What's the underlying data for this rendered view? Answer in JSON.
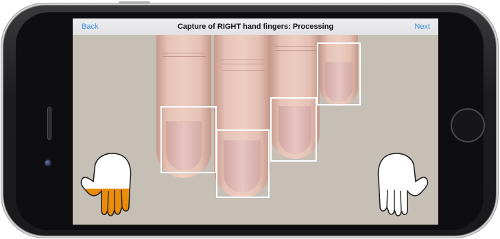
{
  "nav": {
    "back_label": "Back",
    "title": "Capture of RIGHT hand fingers: Processing",
    "next_label": "Next"
  },
  "colors": {
    "link": "#3a8ee6",
    "screen_bg": "#c5bfb6",
    "capture_frame": "#ffffff",
    "progress_fill": "#e98c0a"
  },
  "fingers": [
    {
      "name": "index"
    },
    {
      "name": "middle"
    },
    {
      "name": "ring"
    },
    {
      "name": "little"
    }
  ],
  "hands": {
    "left": {
      "icon": "left-hand-icon",
      "fill_fraction": 0.45
    },
    "right": {
      "icon": "right-hand-icon",
      "fill_fraction": 0
    }
  }
}
